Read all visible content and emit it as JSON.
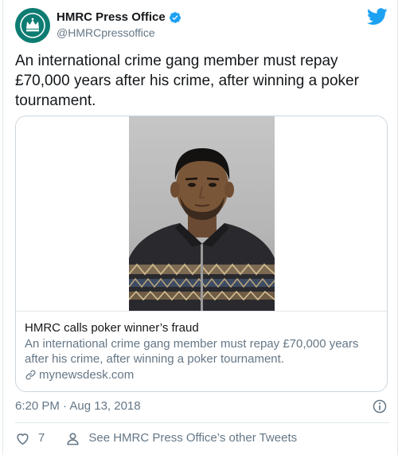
{
  "author": {
    "display_name": "HMRC Press Office",
    "handle": "@HMRCpressoffice"
  },
  "tweet": {
    "text": "An international crime gang member must repay £70,000 years after his crime, after winning a poker tournament."
  },
  "card": {
    "title": "HMRC calls poker winner’s fraud",
    "description": "An international crime gang member must repay £70,000 years after his crime, after winning a poker tournament.",
    "domain": "mynewsdesk.com"
  },
  "meta": {
    "timestamp": "6:20 PM · Aug 13, 2018"
  },
  "actions": {
    "like_count": "7",
    "other_tweets_label": "See HMRC Press Office’s other Tweets"
  },
  "colors": {
    "brand_blue": "#1da1f2",
    "avatar_green": "#0d7c72",
    "secondary_text": "#657786"
  },
  "icons": [
    "crown-logo-icon",
    "verified-badge-icon",
    "twitter-bird-icon",
    "link-icon",
    "info-icon",
    "heart-icon",
    "person-icon"
  ]
}
